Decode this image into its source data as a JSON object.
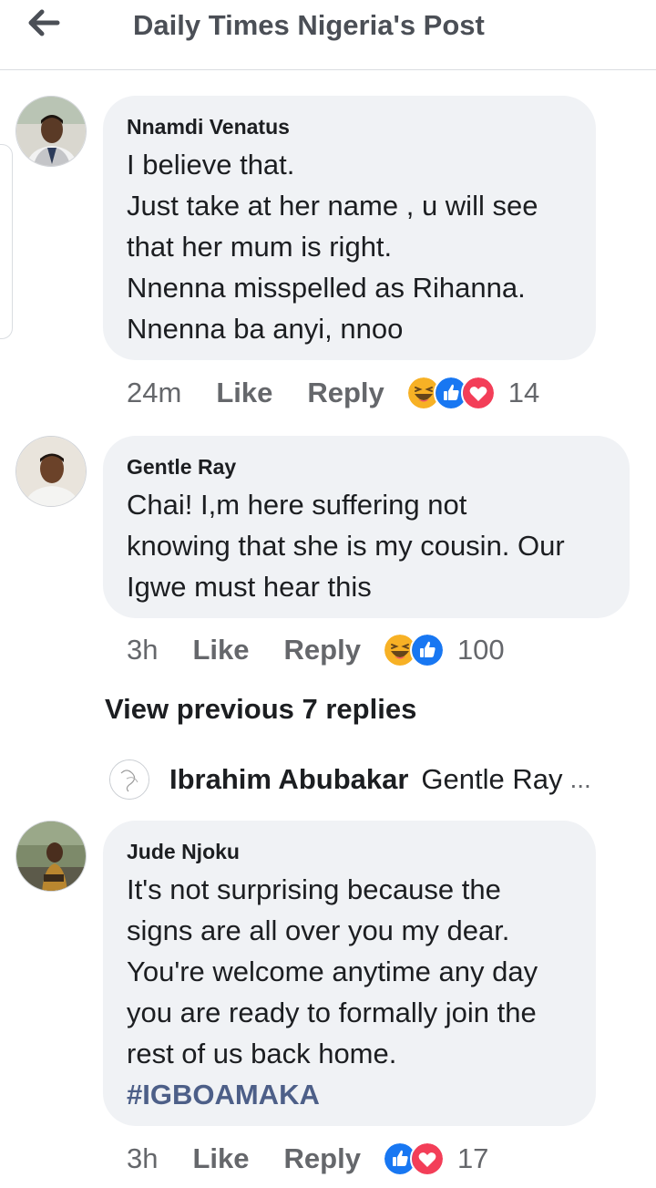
{
  "header": {
    "title": "Daily Times Nigeria's Post",
    "back_icon": "arrow-left-icon"
  },
  "colors": {
    "bubble": "#f0f2f5",
    "meta_text": "#65676b",
    "hashtag": "#4d5f88",
    "like_blue": "#1877f2",
    "love_red": "#f33e58",
    "haha_yellow": "#f7b125"
  },
  "comments": [
    {
      "author": "Nnamdi Venatus",
      "text": "I believe that.\nJust take at her name , u will see\nthat her mum is right.\n Nnenna misspelled as Rihanna.\nNnenna ba anyi, nnoo",
      "time": "24m",
      "like_label": "Like",
      "reply_label": "Reply",
      "reactions": [
        "haha",
        "like",
        "love"
      ],
      "reaction_count": "14"
    },
    {
      "author": "Gentle Ray",
      "text": "Chai! I,m here suffering not\nknowing that she is my cousin. Our\nIgwe must hear this",
      "time": "3h",
      "like_label": "Like",
      "reply_label": "Reply",
      "reactions": [
        "haha",
        "like"
      ],
      "reaction_count": "100"
    },
    {
      "author": "Jude Njoku",
      "text": "It's not surprising because the\nsigns are all over you my dear.\nYou're welcome anytime any day\nyou are ready to formally join the\nrest of us back home.",
      "hashtag": "#IGBOAMAKA",
      "time": "3h",
      "like_label": "Like",
      "reply_label": "Reply",
      "reactions": [
        "like",
        "love"
      ],
      "reaction_count": "17"
    }
  ],
  "replies": {
    "view_previous_label": "View previous 7 replies",
    "latest_reply": {
      "author": "Ibrahim Abubakar",
      "snippet": "Gentle Ray",
      "ellipsis": "..."
    }
  }
}
